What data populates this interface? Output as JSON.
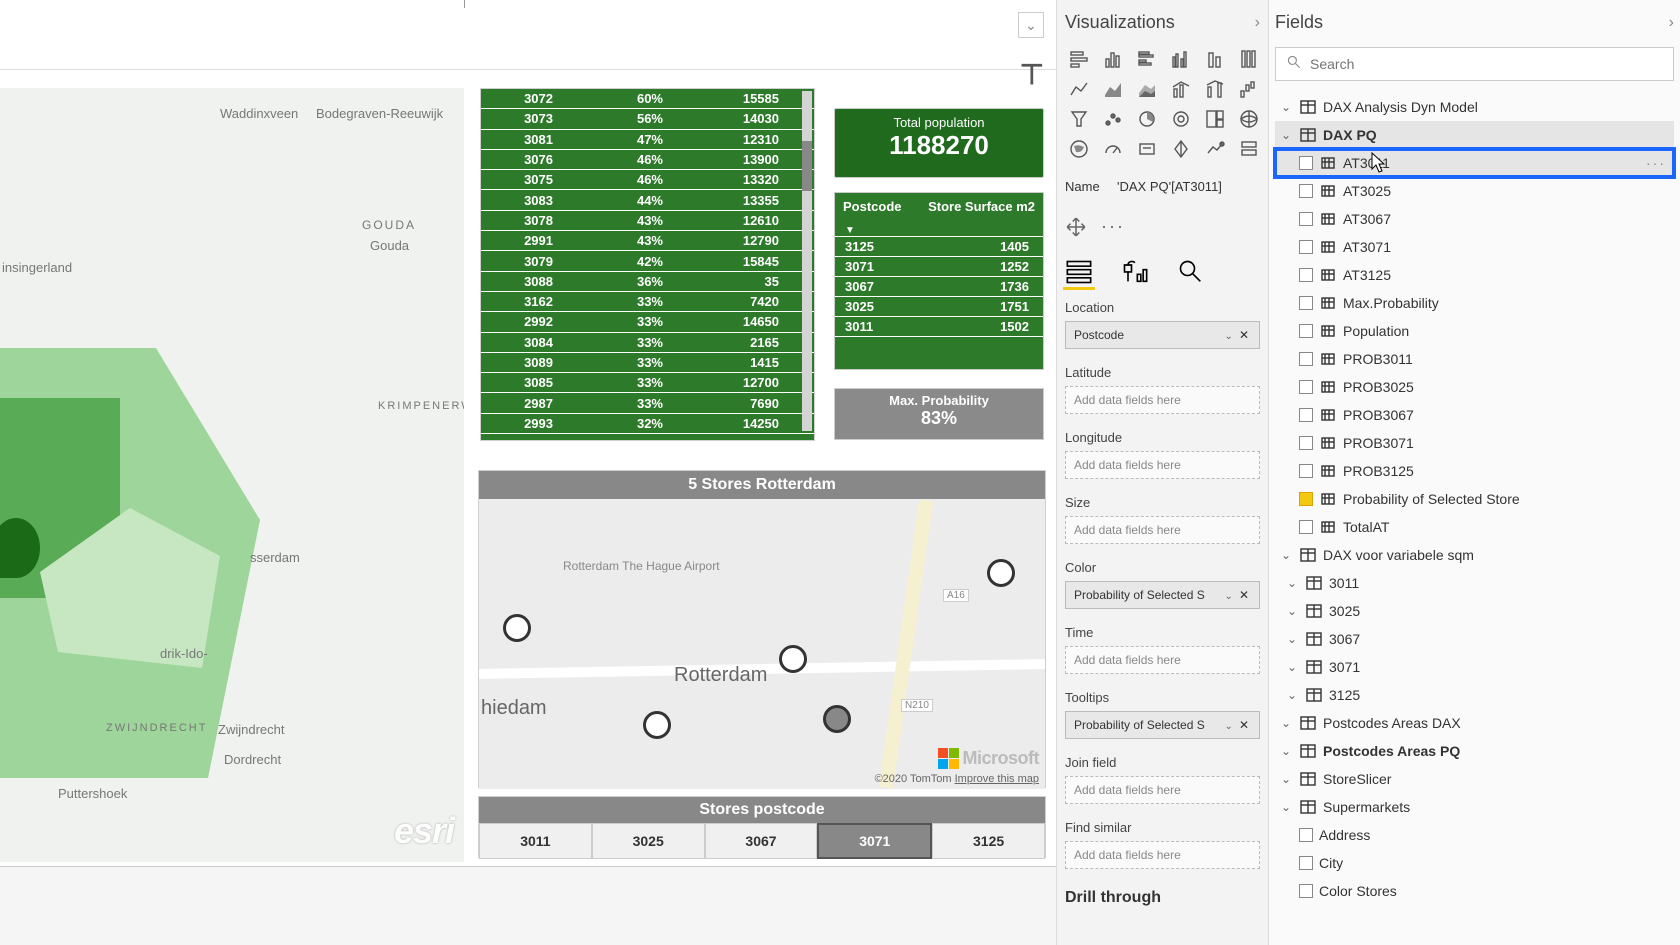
{
  "top_bar": {
    "nav_glyph": "⊤"
  },
  "esri_map": {
    "labels": [
      "Waddinxveen",
      "Bodegraven-Reeuwijk",
      "GOUDA",
      "Gouda",
      "insingerland",
      "KRIMPENERWAARD",
      "sserdam",
      "drik-Ido-",
      "ZWIJNDRECHT",
      "Zwijndrecht",
      "Dordrecht",
      "Puttershoek",
      "hiedam"
    ],
    "attrib": "esri"
  },
  "green_table": {
    "rows": [
      [
        "3072",
        "60%",
        "15585"
      ],
      [
        "3073",
        "56%",
        "14030"
      ],
      [
        "3081",
        "47%",
        "12310"
      ],
      [
        "3076",
        "46%",
        "13900"
      ],
      [
        "3075",
        "46%",
        "13320"
      ],
      [
        "3083",
        "44%",
        "13355"
      ],
      [
        "3078",
        "43%",
        "12610"
      ],
      [
        "2991",
        "43%",
        "12790"
      ],
      [
        "3079",
        "42%",
        "15845"
      ],
      [
        "3088",
        "36%",
        "35"
      ],
      [
        "3162",
        "33%",
        "7420"
      ],
      [
        "2992",
        "33%",
        "14650"
      ],
      [
        "3084",
        "33%",
        "2165"
      ],
      [
        "3089",
        "33%",
        "1415"
      ],
      [
        "3085",
        "33%",
        "12700"
      ],
      [
        "2987",
        "33%",
        "7690"
      ],
      [
        "2993",
        "32%",
        "14250"
      ]
    ]
  },
  "total_population": {
    "label": "Total population",
    "value": "1188270"
  },
  "postcode_surface": {
    "hdr1": "Postcode",
    "hdr2": "Store Surface m2",
    "rows": [
      [
        "3125",
        "1405"
      ],
      [
        "3071",
        "1252"
      ],
      [
        "3067",
        "1736"
      ],
      [
        "3025",
        "1751"
      ],
      [
        "3011",
        "1502"
      ]
    ]
  },
  "max_prob": {
    "label": "Max. Probability",
    "value": "83%"
  },
  "rmap": {
    "title": "5 Stores Rotterdam",
    "city": "Rotterdam",
    "schiedam": "hiedam",
    "airport": "Rotterdam The Hague Airport",
    "a16": "A16",
    "n210": "N210",
    "attrib_prefix": "©2020 TomTom ",
    "attrib_link": "Improve this map",
    "ms": "Microsoft"
  },
  "slicer": {
    "title": "Stores postcode",
    "items": [
      "3011",
      "3025",
      "3067",
      "3071",
      "3125"
    ],
    "selected_index": 3
  },
  "viz_pane": {
    "title": "Visualizations",
    "name_label": "Name",
    "name_value": "'DAX PQ'[AT3011]",
    "wells": {
      "location": "Location",
      "latitude": "Latitude",
      "longitude": "Longitude",
      "size": "Size",
      "color": "Color",
      "time": "Time",
      "tooltips": "Tooltips",
      "join": "Join field",
      "similar": "Find similar",
      "placeholder": "Add data fields here",
      "location_val": "Postcode",
      "color_val": "Probability of Selected S",
      "tooltips_val": "Probability of Selected S"
    },
    "drill": "Drill through"
  },
  "fields_pane": {
    "title": "Fields",
    "search_placeholder": "Search",
    "tables": {
      "t1": "DAX Analysis Dyn Model",
      "t2": "DAX PQ",
      "t2_fields": [
        "AT3011",
        "AT3025",
        "AT3067",
        "AT3071",
        "AT3125",
        "Max.Probability",
        "Population",
        "PROB3011",
        "PROB3025",
        "PROB3067",
        "PROB3071",
        "PROB3125",
        "Probability of Selected Store",
        "TotalAT"
      ],
      "t2_checked_index": 12,
      "t3": "DAX voor variabele sqm",
      "t3_children": [
        "3011",
        "3025",
        "3067",
        "3071",
        "3125"
      ],
      "t4": "Postcodes Areas DAX",
      "t5": "Postcodes Areas PQ",
      "t6": "StoreSlicer",
      "t7": "Supermarkets",
      "t7_fields": [
        "Address",
        "City",
        "Color Stores"
      ]
    }
  }
}
